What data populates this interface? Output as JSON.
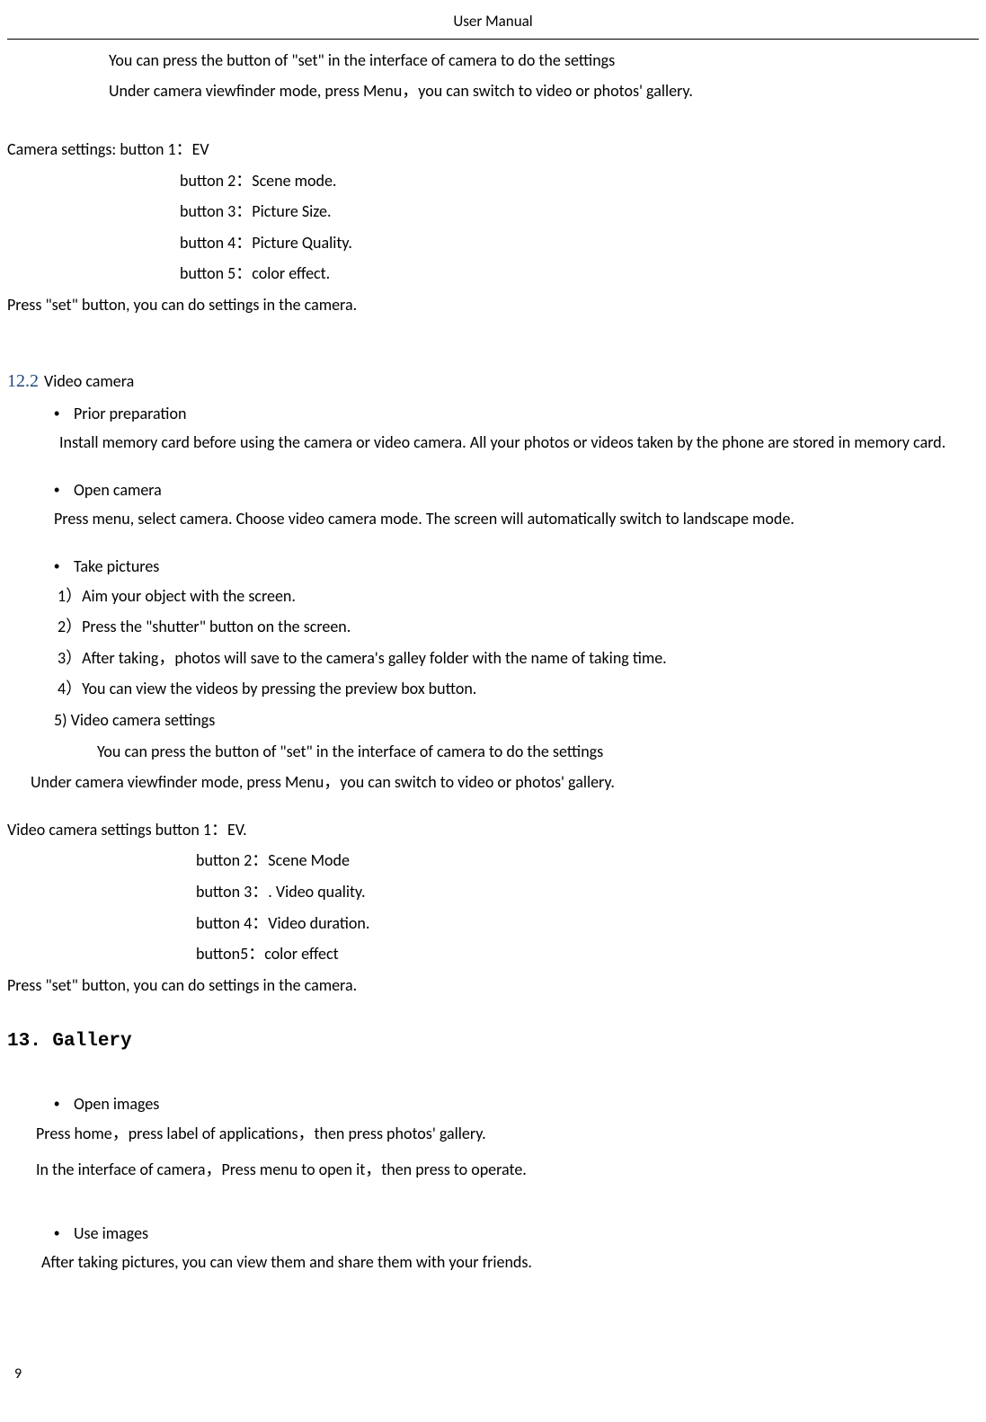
{
  "header": "User Manual",
  "intro": {
    "l1": "You can press the button of \"set\" in the interface of camera to do the settings",
    "l2": "Under camera viewfinder mode, press Menu，you can switch to video or photos' gallery."
  },
  "camera_settings": {
    "b1": "Camera settings: button 1：EV",
    "b2": "button 2：Scene mode.",
    "b3": "button 3：Picture Size.",
    "b4": "button 4：Picture Quality.",
    "b5": "button 5：color effect.",
    "press": "Press \"set\" button, you can do settings in the camera."
  },
  "s12_2": {
    "num": "12.2",
    "title": "Video camera",
    "prior": "Prior preparation",
    "prior_text": "Install memory card before using the camera or video camera. All your photos or videos taken by the phone are stored in memory card.",
    "open": "Open camera",
    "open_text": "Press menu, select camera. Choose video camera mode. The screen will automatically switch to landscape mode.",
    "take": "Take pictures",
    "step1": "1）Aim your object with the screen.",
    "step2": "2）Press the \"shutter\" button on the screen.",
    "step3": "3）After taking，photos will save to the camera's galley folder with the name of taking time.",
    "step4": "4）You can view the videos by pressing the preview box button.",
    "step5": "5) Video camera settings",
    "step5_sub": "You can press the button of \"set\" in the interface of camera to do the settings",
    "viewfinder": "Under camera viewfinder mode, press Menu，you can switch to video or photos' gallery."
  },
  "video_settings": {
    "b1": "Video camera settings button 1：EV.",
    "b2": "button 2：Scene Mode",
    "b3": "button 3：. Video quality.",
    "b4": "button 4：Video duration.",
    "b5": "button5：color effect",
    "press": "Press \"set\" button, you can do settings in the camera."
  },
  "s13": {
    "title": "13. Gallery",
    "open": "Open images",
    "open_l1": "Press home，press label of applications，then press photos' gallery.",
    "open_l2": "In the interface of camera，Press menu to open it，then press to operate.",
    "use": "Use images",
    "use_text": "After taking pictures, you can view them and share them with your friends."
  },
  "page_num": "9"
}
